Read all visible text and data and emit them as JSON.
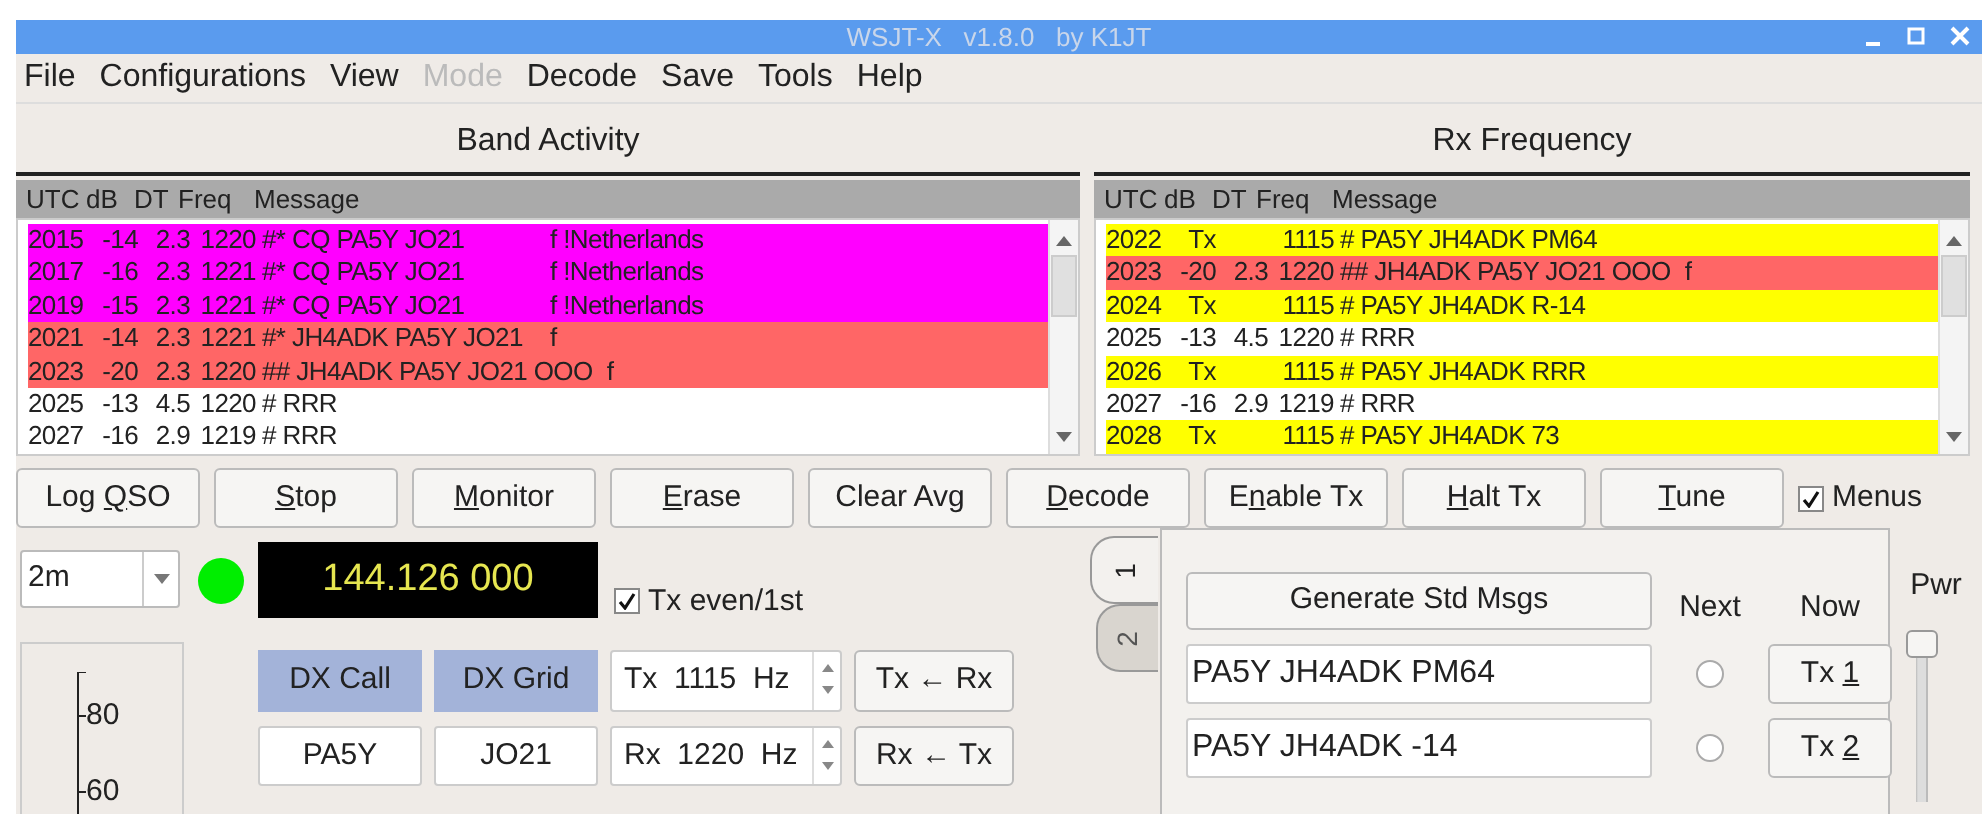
{
  "window": {
    "title": "WSJT-X   v1.8.0   by K1JT"
  },
  "menu": [
    {
      "label": "File",
      "disabled": false
    },
    {
      "label": "Configurations",
      "disabled": false
    },
    {
      "label": "View",
      "disabled": false
    },
    {
      "label": "Mode",
      "disabled": true
    },
    {
      "label": "Decode",
      "disabled": false
    },
    {
      "label": "Save",
      "disabled": false
    },
    {
      "label": "Tools",
      "disabled": false
    },
    {
      "label": "Help",
      "disabled": false
    }
  ],
  "band_activity": {
    "title": "Band Activity",
    "columns": [
      "UTC",
      "dB",
      "DT",
      "Freq",
      "Message"
    ],
    "rows": [
      {
        "utc": "2015",
        "db": "-14",
        "dt": "2.3",
        "freq": "1220",
        "message": "#* CQ PA5Y JO21",
        "info": "f !Netherlands",
        "color": "#ff00ff"
      },
      {
        "utc": "2017",
        "db": "-16",
        "dt": "2.3",
        "freq": "1221",
        "message": "#* CQ PA5Y JO21",
        "info": "f !Netherlands",
        "color": "#ff00ff"
      },
      {
        "utc": "2019",
        "db": "-15",
        "dt": "2.3",
        "freq": "1221",
        "message": "#* CQ PA5Y JO21",
        "info": "f !Netherlands",
        "color": "#ff00ff"
      },
      {
        "utc": "2021",
        "db": "-14",
        "dt": "2.3",
        "freq": "1221",
        "message": "#* JH4ADK PA5Y JO21",
        "info": "f",
        "color": "#ff6666"
      },
      {
        "utc": "2023",
        "db": "-20",
        "dt": "2.3",
        "freq": "1220",
        "message": "## JH4ADK PA5Y JO21 OOO",
        "info": "f",
        "color": "#ff6666"
      },
      {
        "utc": "2025",
        "db": "-13",
        "dt": "4.5",
        "freq": "1220",
        "message": "# RRR",
        "color": "#ffffff"
      },
      {
        "utc": "2027",
        "db": "-16",
        "dt": "2.9",
        "freq": "1219",
        "message": "# RRR",
        "color": "#ffffff"
      }
    ]
  },
  "rx_frequency": {
    "title": "Rx Frequency",
    "columns": [
      "UTC",
      "dB",
      "DT",
      "Freq",
      "Message"
    ],
    "rows": [
      {
        "utc": "2022",
        "db": "Tx",
        "freq": "1115",
        "message": "# PA5Y JH4ADK PM64",
        "color": "#ffff00"
      },
      {
        "utc": "2023",
        "db": "-20",
        "dt": "2.3",
        "freq": "1220",
        "message": "## JH4ADK PA5Y JO21 OOO",
        "info": "f",
        "color": "#ff6666"
      },
      {
        "utc": "2024",
        "db": "Tx",
        "freq": "1115",
        "message": "# PA5Y JH4ADK R-14",
        "color": "#ffff00"
      },
      {
        "utc": "2025",
        "db": "-13",
        "dt": "4.5",
        "freq": "1220",
        "message": "# RRR",
        "color": "#ffffff"
      },
      {
        "utc": "2026",
        "db": "Tx",
        "freq": "1115",
        "message": "# PA5Y JH4ADK RRR",
        "color": "#ffff00"
      },
      {
        "utc": "2027",
        "db": "-16",
        "dt": "2.9",
        "freq": "1219",
        "message": "# RRR",
        "color": "#ffffff"
      },
      {
        "utc": "2028",
        "db": "Tx",
        "freq": "1115",
        "message": "# PA5Y JH4ADK 73",
        "color": "#ffff00"
      }
    ]
  },
  "buttons": [
    {
      "before": "Log ",
      "key": "Q",
      "after": "SO"
    },
    {
      "key": "S",
      "after": "top"
    },
    {
      "key": "M",
      "after": "onitor"
    },
    {
      "key": "E",
      "after": "rase"
    },
    {
      "before": "Clear Avg"
    },
    {
      "key": "D",
      "after": "ecode"
    },
    {
      "before": "E",
      "key": "n",
      "after": "able Tx"
    },
    {
      "key": "H",
      "after": "alt Tx"
    },
    {
      "key": "T",
      "after": "une"
    }
  ],
  "menus_toggle": {
    "label": "Menus",
    "checked": true
  },
  "band": {
    "value": "2m"
  },
  "status_light": {
    "on": true
  },
  "frequency": "144.126 000",
  "tx_even": {
    "label": "Tx even/1st",
    "checked": true
  },
  "meter": {
    "ticks": [
      "80",
      "60"
    ]
  },
  "dx": {
    "call_label": "DX Call",
    "grid_label": "DX Grid",
    "call": "PA5Y",
    "grid": "JO21"
  },
  "spinboxes": [
    "Tx  1115  Hz",
    "Rx  1220  Hz"
  ],
  "swap_buttons": [
    "Tx ← Rx",
    "Rx ← Tx"
  ],
  "tabs": [
    {
      "label": "1",
      "selected": true
    },
    {
      "label": "2",
      "selected": false
    }
  ],
  "generate_button": "Generate Std Msgs",
  "next_label": "Next",
  "now_label": "Now",
  "messages": [
    {
      "text": "PA5Y JH4ADK PM64",
      "next": false,
      "now": {
        "before": "Tx ",
        "key": "1"
      }
    },
    {
      "text": "PA5Y JH4ADK -14",
      "next": false,
      "now": {
        "before": "Tx ",
        "key": "2"
      }
    }
  ],
  "power": {
    "label": "Pwr",
    "level": 1
  }
}
